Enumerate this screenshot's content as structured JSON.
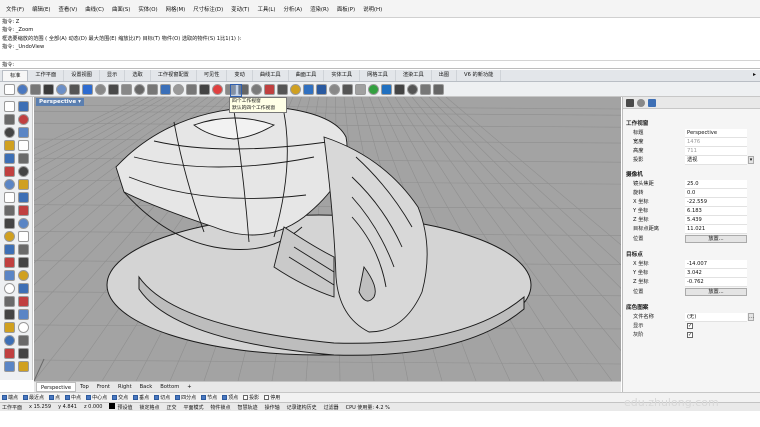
{
  "menubar": {
    "items": [
      "文件(F)",
      "编辑(E)",
      "查看(V)",
      "曲线(C)",
      "曲面(S)",
      "实体(O)",
      "网格(M)",
      "尺寸标注(D)",
      "变动(T)",
      "工具(L)",
      "分析(A)",
      "渲染(R)",
      "面板(P)",
      "说明(H)"
    ]
  },
  "command_history": {
    "lines": [
      "指令: Z",
      "指令: _Zoom",
      "框选要缩放的范围 ( 全部(A) 动态(D) 最大范围(E) 缩放比(F) 目标(T) 物件(O) 选取的物件(S) 1比1(1) ):",
      "指令: _UndoView"
    ],
    "prompt": "指令:"
  },
  "toolbar_tabs": {
    "items": [
      "标准",
      "工作平面",
      "设置视图",
      "显示",
      "选取",
      "工作视窗配置",
      "可见性",
      "变动",
      "曲线工具",
      "曲面工具",
      "实体工具",
      "网格工具",
      "渲染工具",
      "出图",
      "V6 的新功能"
    ],
    "active_index": 0
  },
  "tooltip": {
    "line1": "四个工作视窗",
    "line2": "默认的四个工作视窗"
  },
  "viewport": {
    "label": "Perspective ▾",
    "tabs": [
      "Perspective",
      "Top",
      "Front",
      "Right",
      "Back",
      "Bottom",
      "+"
    ],
    "active_tab": 0
  },
  "osnap": {
    "items": [
      {
        "label": "端点",
        "checked": true
      },
      {
        "label": "最近点",
        "checked": true
      },
      {
        "label": "点",
        "checked": true
      },
      {
        "label": "中点",
        "checked": true
      },
      {
        "label": "中心点",
        "checked": true
      },
      {
        "label": "交点",
        "checked": true
      },
      {
        "label": "垂点",
        "checked": true
      },
      {
        "label": "切点",
        "checked": true
      },
      {
        "label": "四分点",
        "checked": true
      },
      {
        "label": "节点",
        "checked": true
      },
      {
        "label": "顶点",
        "checked": true
      },
      {
        "label": "投影",
        "checked": false
      },
      {
        "label": "停用",
        "checked": false
      }
    ]
  },
  "statusbar": {
    "cplane": "工作平面",
    "x": "x 15.259",
    "y": "y 4.841",
    "z": "z 0.000",
    "layer": "预设值",
    "items": [
      "锁定格点",
      "正交",
      "平面模式",
      "物件锁点",
      "智慧轨迹",
      "操作轴",
      "记录建构历史",
      "过滤器",
      "CPU 使用量: 4.2 %"
    ]
  },
  "panel": {
    "section_viewport": "工作视窗",
    "title_label": "标题",
    "title_value": "Perspective",
    "width_label": "宽度",
    "width_value": "1476",
    "height_label": "高度",
    "height_value": "711",
    "projection_label": "投影",
    "projection_value": "透视",
    "section_camera": "摄像机",
    "lens_label": "镜头焦距",
    "lens_value": "25.0",
    "rotation_label": "旋转",
    "rotation_value": "0.0",
    "cam_x_label": "X 坐标",
    "cam_x_value": "-22.559",
    "cam_y_label": "Y 坐标",
    "cam_y_value": "6.183",
    "cam_z_label": "Z 坐标",
    "cam_z_value": "5.439",
    "target_dist_label": "目标点距离",
    "target_dist_value": "11.021",
    "position_label": "位置",
    "place_button": "放置...",
    "section_target": "目标点",
    "tgt_x_label": "X 坐标",
    "tgt_x_value": "-14.007",
    "tgt_y_label": "Y 坐标",
    "tgt_y_value": "3.042",
    "tgt_z_label": "Z 坐标",
    "tgt_z_value": "-0.762",
    "tgt_position_label": "位置",
    "tgt_place_button": "放置...",
    "section_background": "底色图案",
    "filename_label": "文件名称",
    "filename_value": "(无)",
    "show_label": "显示",
    "gray_label": "灰阶"
  },
  "watermark": "edu.zhulong.com",
  "colors": {
    "viewport_bg": "#a3a3a3",
    "grid": "#8d8d8d",
    "model_fill": "#dcdcdc",
    "model_edge": "#1a1a1a",
    "active_tab": "#5b7fb0"
  }
}
